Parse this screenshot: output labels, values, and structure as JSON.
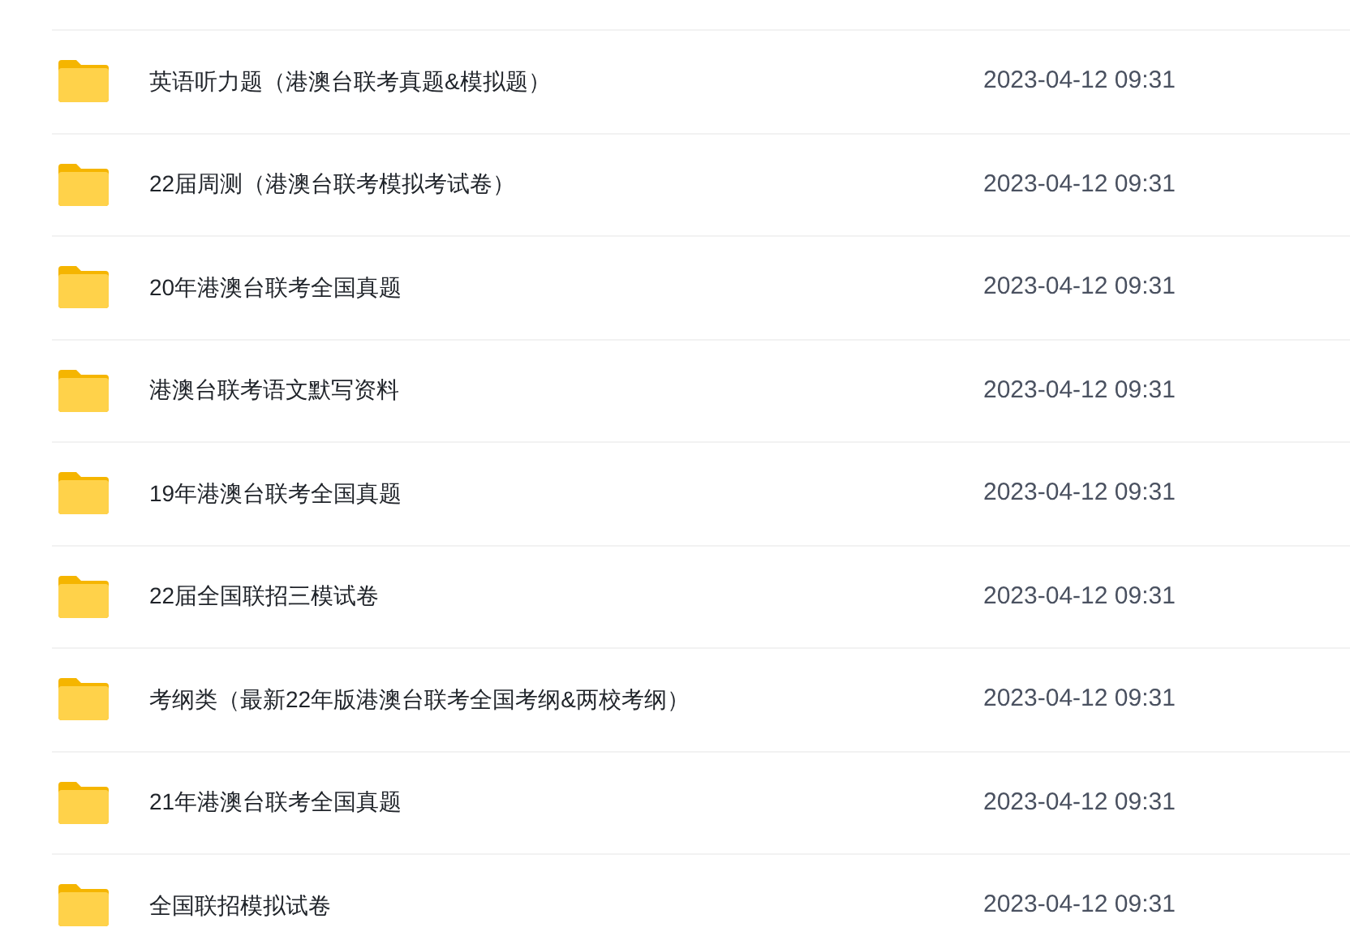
{
  "files": [
    {
      "name": "英语听力题（港澳台联考真题&模拟题）",
      "modified": "2023-04-12 09:31"
    },
    {
      "name": "22届周测（港澳台联考模拟考试卷）",
      "modified": "2023-04-12 09:31"
    },
    {
      "name": "20年港澳台联考全国真题",
      "modified": "2023-04-12 09:31"
    },
    {
      "name": "港澳台联考语文默写资料",
      "modified": "2023-04-12 09:31"
    },
    {
      "name": "19年港澳台联考全国真题",
      "modified": "2023-04-12 09:31"
    },
    {
      "name": "22届全国联招三模试卷",
      "modified": "2023-04-12 09:31"
    },
    {
      "name": "考纲类（最新22年版港澳台联考全国考纲&两校考纲）",
      "modified": "2023-04-12 09:31"
    },
    {
      "name": "21年港澳台联考全国真题",
      "modified": "2023-04-12 09:31"
    },
    {
      "name": "全国联招模拟试卷",
      "modified": "2023-04-12 09:31"
    }
  ]
}
